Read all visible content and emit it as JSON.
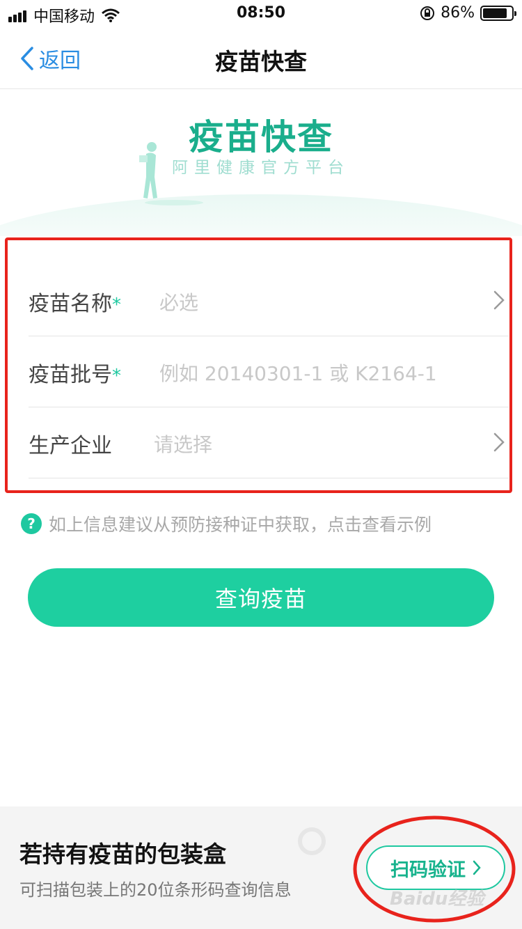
{
  "status_bar": {
    "carrier": "中国移动",
    "time": "08:50",
    "battery_percent": "86%",
    "battery_level": 0.86
  },
  "nav": {
    "back_label": "返回",
    "title": "疫苗快查"
  },
  "hero": {
    "title": "疫苗快查",
    "subtitle": "阿里健康官方平台"
  },
  "form": {
    "rows": [
      {
        "label": "疫苗名称",
        "required": "*",
        "placeholder": "必选"
      },
      {
        "label": "疫苗批号",
        "required": "*",
        "placeholder": "例如 20140301-1 或 K2164-1"
      },
      {
        "label": "生产企业",
        "required": "",
        "placeholder": "请选择"
      }
    ]
  },
  "hint": {
    "icon": "?",
    "text": "如上信息建议从预防接种证中获取，点击查看示例"
  },
  "query_button": {
    "label": "查询疫苗"
  },
  "banner": {
    "title": "若持有疫苗的包装盒",
    "subtitle": "可扫描包装上的20位条形码查询信息",
    "scan_button": "扫码验证"
  },
  "watermark": "Baidu经验",
  "colors": {
    "accent": "#1ecfa0",
    "link": "#2a8de2",
    "annotation_red": "#e8231c"
  }
}
